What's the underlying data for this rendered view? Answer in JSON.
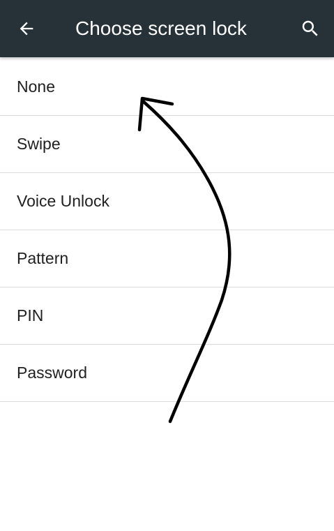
{
  "toolbar": {
    "title": "Choose screen lock",
    "back_icon": "arrow-back-icon",
    "search_icon": "search-icon",
    "background_color": "#263238"
  },
  "options": [
    {
      "label": "None"
    },
    {
      "label": "Swipe"
    },
    {
      "label": "Voice Unlock"
    },
    {
      "label": "Pattern"
    },
    {
      "label": "PIN"
    },
    {
      "label": "Password"
    }
  ]
}
